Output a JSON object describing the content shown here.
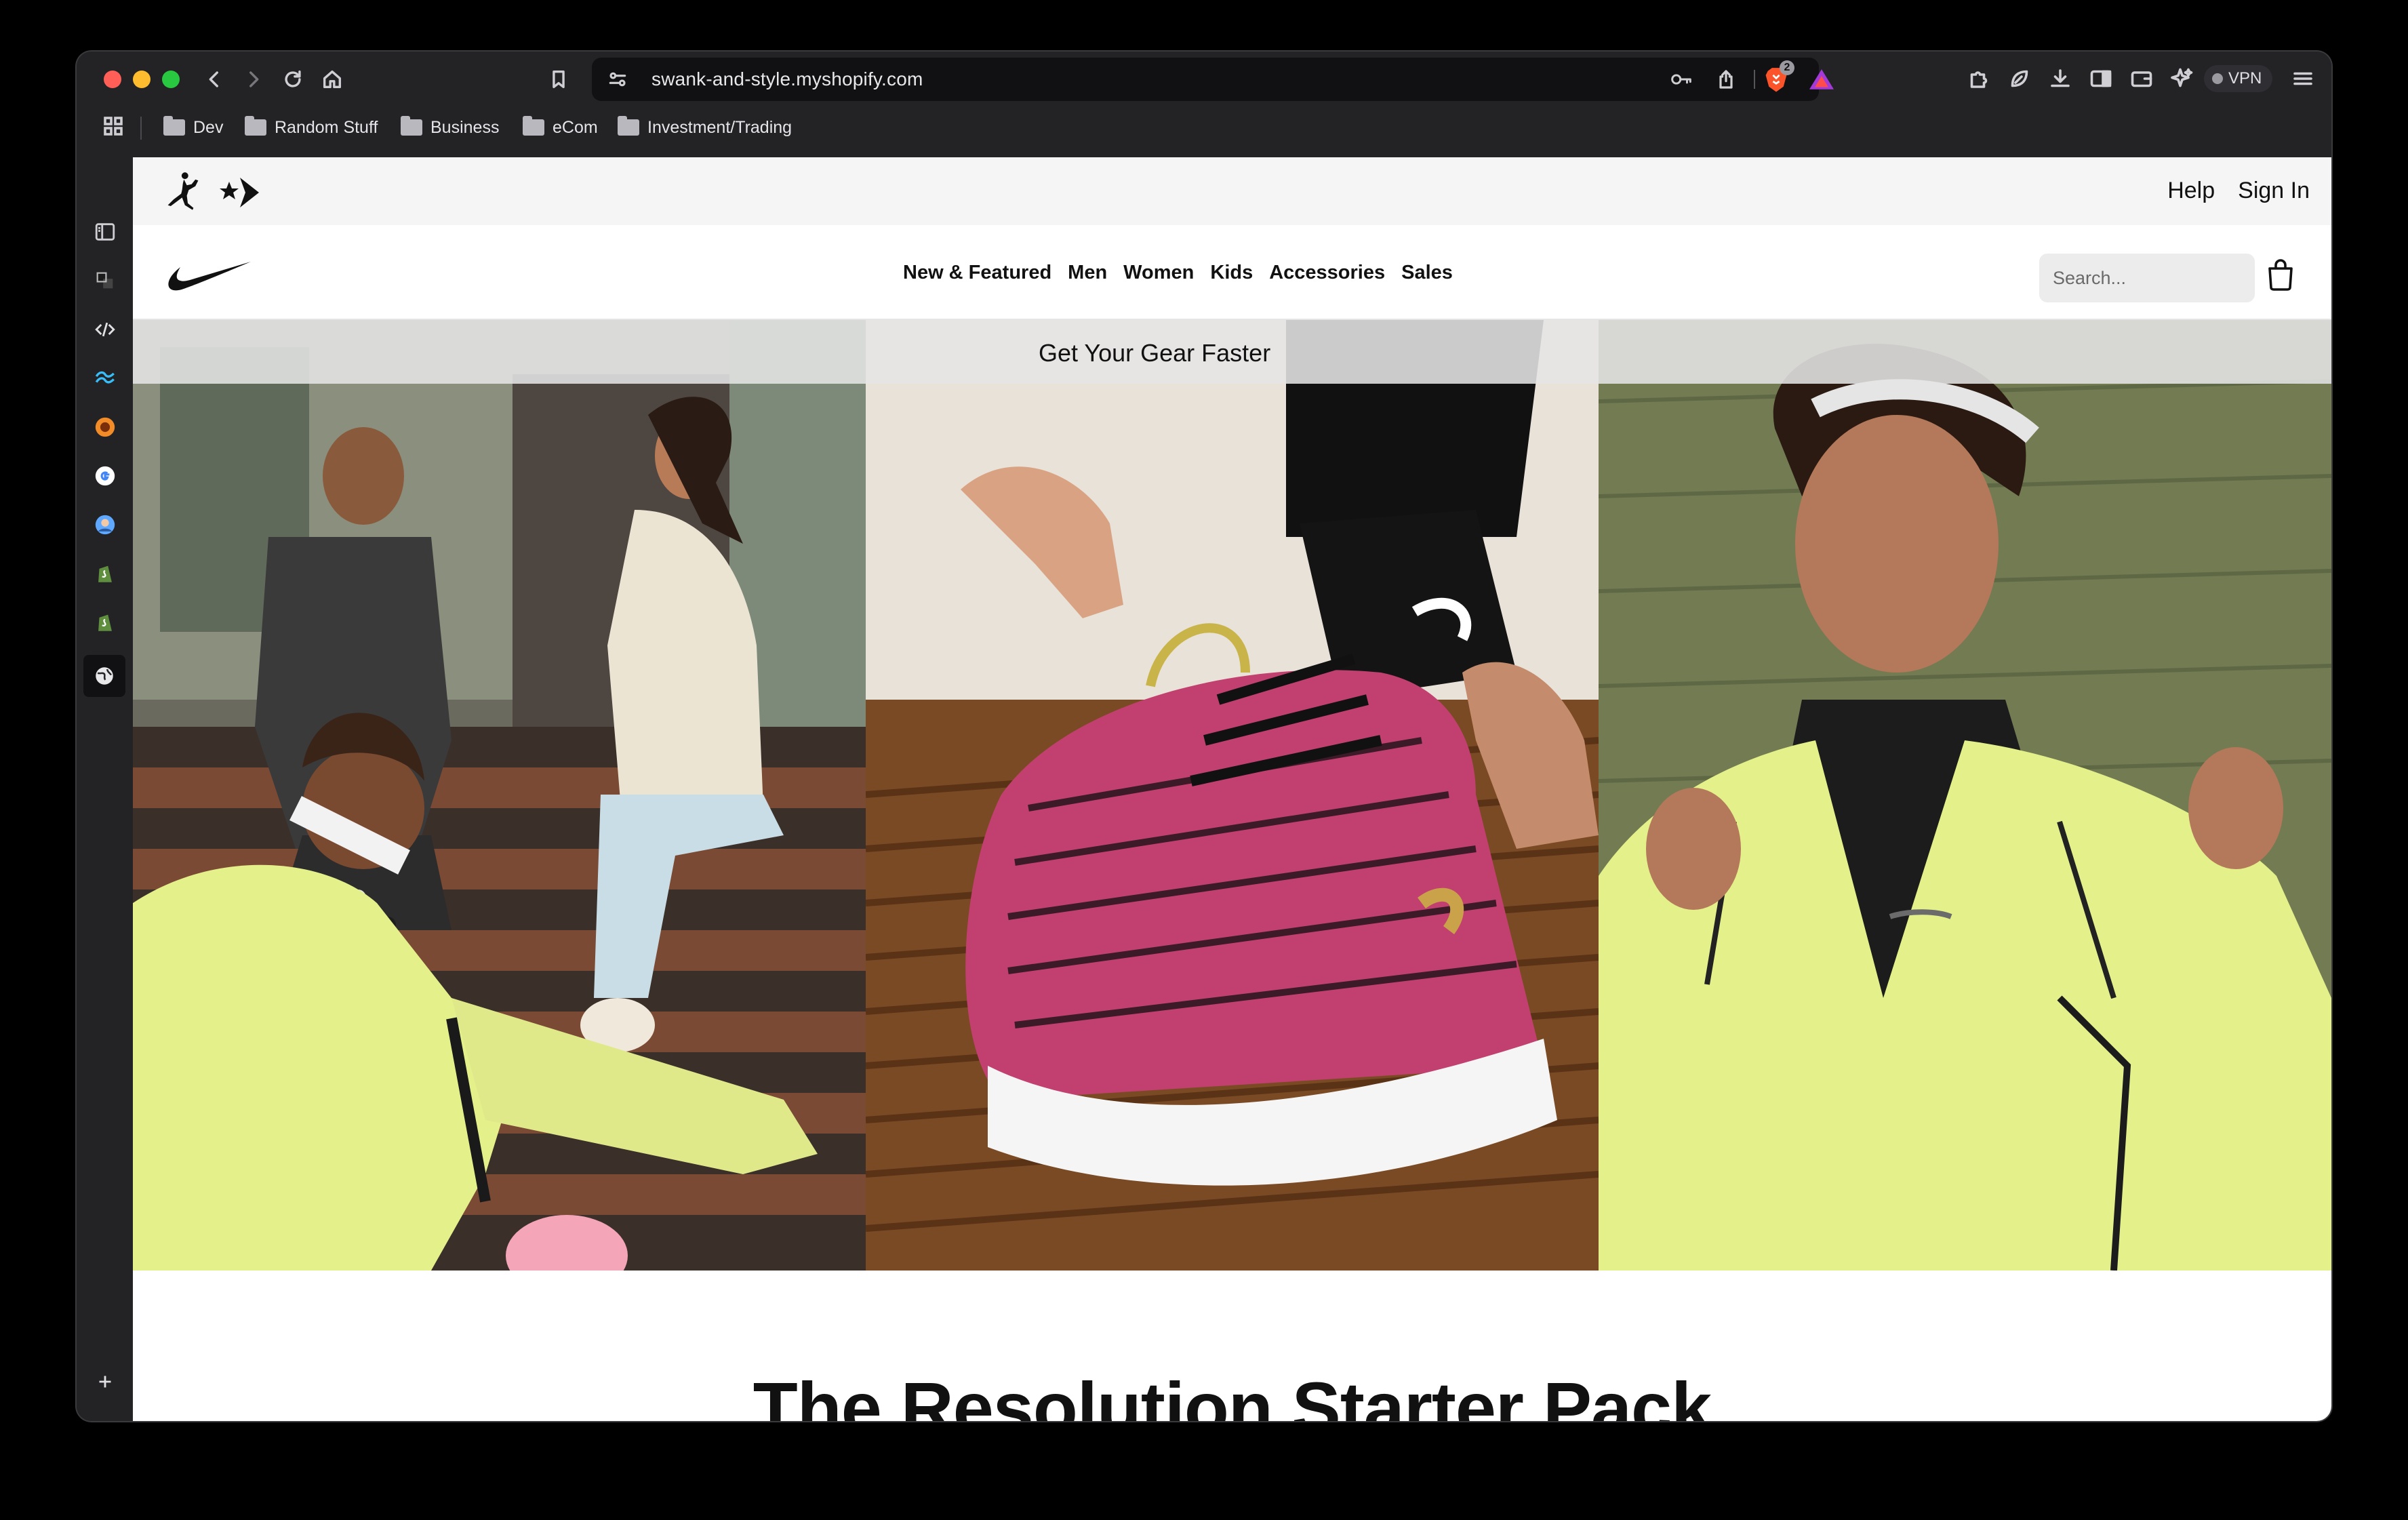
{
  "browser": {
    "url": "swank-and-style.myshopify.com",
    "brave_badge": "2",
    "vpn_label": "VPN"
  },
  "bookmarks": [
    {
      "label": "Dev"
    },
    {
      "label": "Random Stuff"
    },
    {
      "label": "Business"
    },
    {
      "label": "eCom"
    },
    {
      "label": "Investment/Trading"
    }
  ],
  "sidebar_icons": [
    "sidebar-toggle-icon",
    "app-icon",
    "code-icon",
    "tailwind-icon",
    "app-icon",
    "google-icon",
    "avatar-icon",
    "shopify-icon",
    "shopify-icon",
    "globe-icon",
    "add-icon"
  ],
  "site": {
    "top_links": {
      "help": "Help",
      "sign_in": "Sign In"
    },
    "nav": {
      "new_featured": "New & Featured",
      "men": "Men",
      "women": "Women",
      "kids": "Kids",
      "accessories": "Accessories",
      "sales": "Sales"
    },
    "search": {
      "placeholder": "Search..."
    },
    "promo": "Get Your Gear Faster",
    "headline": "The Resolution Starter Pack"
  },
  "colors": {
    "accent_yellow": "#e4f08a",
    "shoe_pink": "#c2406f",
    "browser_chrome": "#232326"
  }
}
